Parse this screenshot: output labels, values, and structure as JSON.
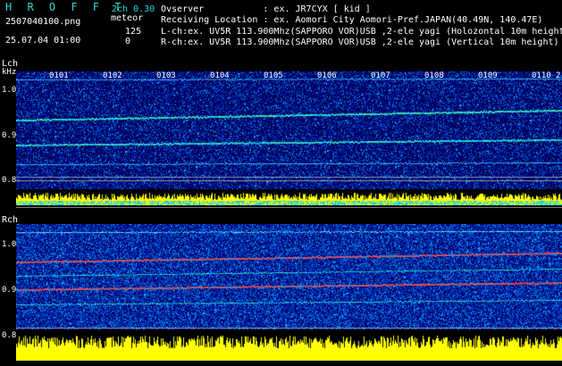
{
  "header": {
    "title": "H R O F F T",
    "filename": "2507040100.png",
    "datetime": "25.07.04 01:00",
    "mode": "2ch 0.30",
    "event_label": "meteor",
    "count_top": "125",
    "count_bottom": "0",
    "observer": "Ovserver           : ex. JR7CYX [ kid ]",
    "location": "Receiving Location : ex. Aomori City Aomori-Pref.JAPAN(40.49N, 140.47E)",
    "lch_info": "L-ch:ex. UV5R 113.900Mhz(SAPPORO VOR)USB ,2-ele yagi (Holozontal 10m height)",
    "rch_info": "R-ch:ex. UV5R 113.900Mhz(SAPPORO VOR)USB ,2-ele yagi (Vertical 10m height)"
  },
  "lch": {
    "label": "Lch",
    "unit": "kHz",
    "ticks": [
      "1.0",
      "0.9",
      "0.8"
    ],
    "time_ticks": [
      "0101",
      "0102",
      "0103",
      "0104",
      "0105",
      "0106",
      "0107",
      "0108",
      "0109",
      "0110"
    ],
    "tail_tick": "2"
  },
  "rch": {
    "label": "Rch",
    "ticks": [
      "1.0",
      "0.9",
      "0.8"
    ]
  },
  "colors": {
    "title": "#2fd4d4",
    "mode": "#2fd4d4",
    "bg_spectrum": "#00005a",
    "signal_trace": "#3fe0a0",
    "strong_trace": "#ff3030",
    "amplitude": "#ffff00",
    "level_bar": "#00c8ff"
  }
}
